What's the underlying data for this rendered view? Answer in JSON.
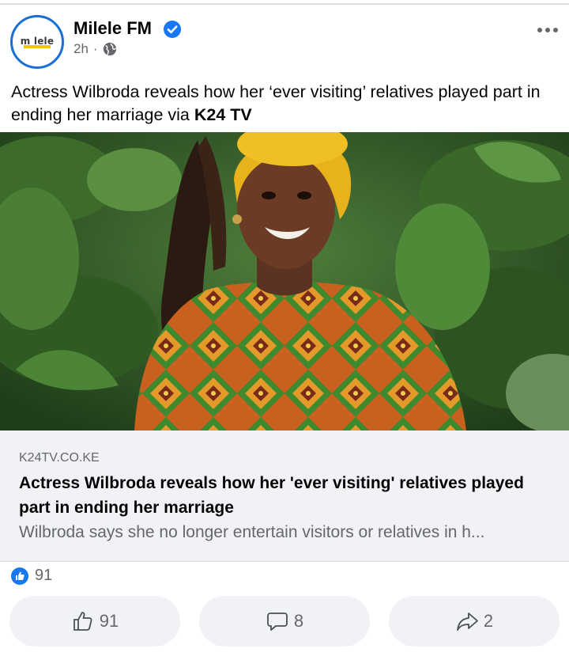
{
  "post": {
    "page_name": "Milele FM",
    "avatar_logo_text": "m lele",
    "time": "2h",
    "dot": "·",
    "text_prefix": "Actress Wilbroda reveals how her ‘ever visiting’ relatives played part in ending her marriage via ",
    "text_bold": "K24 TV"
  },
  "link": {
    "domain": "K24TV.CO.KE",
    "title": "Actress Wilbroda reveals how her 'ever visiting' relatives played part in ending her marriage",
    "description": "Wilbroda says she no longer entertain visitors or relatives in h..."
  },
  "reactions": {
    "count": "91"
  },
  "actions": {
    "like_count": "91",
    "comment_count": "8",
    "share_count": "2"
  },
  "colors": {
    "brand_blue": "#1877f2",
    "muted_text": "#65676b",
    "card_bg": "#f0f2f5"
  },
  "icons": [
    "verified-badge-icon",
    "globe-icon",
    "more-options-icon",
    "like-reaction-icon",
    "thumbs-up-icon",
    "comment-icon",
    "share-icon"
  ]
}
